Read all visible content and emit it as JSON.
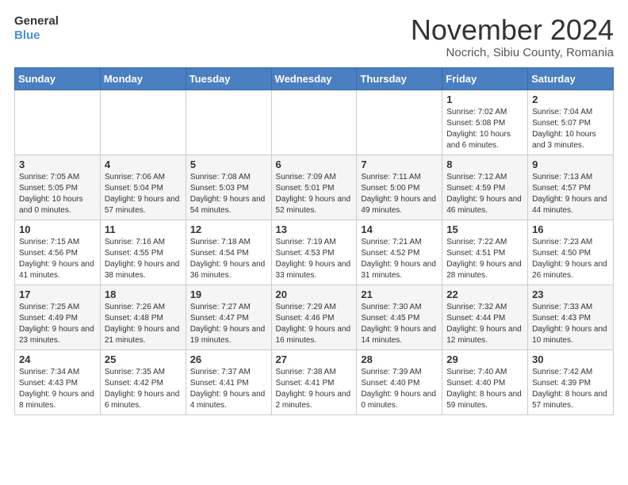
{
  "logo": {
    "general": "General",
    "blue": "Blue"
  },
  "title": "November 2024",
  "subtitle": "Nocrich, Sibiu County, Romania",
  "days_of_week": [
    "Sunday",
    "Monday",
    "Tuesday",
    "Wednesday",
    "Thursday",
    "Friday",
    "Saturday"
  ],
  "weeks": [
    [
      {
        "day": "",
        "info": ""
      },
      {
        "day": "",
        "info": ""
      },
      {
        "day": "",
        "info": ""
      },
      {
        "day": "",
        "info": ""
      },
      {
        "day": "",
        "info": ""
      },
      {
        "day": "1",
        "info": "Sunrise: 7:02 AM\nSunset: 5:08 PM\nDaylight: 10 hours and 6 minutes."
      },
      {
        "day": "2",
        "info": "Sunrise: 7:04 AM\nSunset: 5:07 PM\nDaylight: 10 hours and 3 minutes."
      }
    ],
    [
      {
        "day": "3",
        "info": "Sunrise: 7:05 AM\nSunset: 5:05 PM\nDaylight: 10 hours and 0 minutes."
      },
      {
        "day": "4",
        "info": "Sunrise: 7:06 AM\nSunset: 5:04 PM\nDaylight: 9 hours and 57 minutes."
      },
      {
        "day": "5",
        "info": "Sunrise: 7:08 AM\nSunset: 5:03 PM\nDaylight: 9 hours and 54 minutes."
      },
      {
        "day": "6",
        "info": "Sunrise: 7:09 AM\nSunset: 5:01 PM\nDaylight: 9 hours and 52 minutes."
      },
      {
        "day": "7",
        "info": "Sunrise: 7:11 AM\nSunset: 5:00 PM\nDaylight: 9 hours and 49 minutes."
      },
      {
        "day": "8",
        "info": "Sunrise: 7:12 AM\nSunset: 4:59 PM\nDaylight: 9 hours and 46 minutes."
      },
      {
        "day": "9",
        "info": "Sunrise: 7:13 AM\nSunset: 4:57 PM\nDaylight: 9 hours and 44 minutes."
      }
    ],
    [
      {
        "day": "10",
        "info": "Sunrise: 7:15 AM\nSunset: 4:56 PM\nDaylight: 9 hours and 41 minutes."
      },
      {
        "day": "11",
        "info": "Sunrise: 7:16 AM\nSunset: 4:55 PM\nDaylight: 9 hours and 38 minutes."
      },
      {
        "day": "12",
        "info": "Sunrise: 7:18 AM\nSunset: 4:54 PM\nDaylight: 9 hours and 36 minutes."
      },
      {
        "day": "13",
        "info": "Sunrise: 7:19 AM\nSunset: 4:53 PM\nDaylight: 9 hours and 33 minutes."
      },
      {
        "day": "14",
        "info": "Sunrise: 7:21 AM\nSunset: 4:52 PM\nDaylight: 9 hours and 31 minutes."
      },
      {
        "day": "15",
        "info": "Sunrise: 7:22 AM\nSunset: 4:51 PM\nDaylight: 9 hours and 28 minutes."
      },
      {
        "day": "16",
        "info": "Sunrise: 7:23 AM\nSunset: 4:50 PM\nDaylight: 9 hours and 26 minutes."
      }
    ],
    [
      {
        "day": "17",
        "info": "Sunrise: 7:25 AM\nSunset: 4:49 PM\nDaylight: 9 hours and 23 minutes."
      },
      {
        "day": "18",
        "info": "Sunrise: 7:26 AM\nSunset: 4:48 PM\nDaylight: 9 hours and 21 minutes."
      },
      {
        "day": "19",
        "info": "Sunrise: 7:27 AM\nSunset: 4:47 PM\nDaylight: 9 hours and 19 minutes."
      },
      {
        "day": "20",
        "info": "Sunrise: 7:29 AM\nSunset: 4:46 PM\nDaylight: 9 hours and 16 minutes."
      },
      {
        "day": "21",
        "info": "Sunrise: 7:30 AM\nSunset: 4:45 PM\nDaylight: 9 hours and 14 minutes."
      },
      {
        "day": "22",
        "info": "Sunrise: 7:32 AM\nSunset: 4:44 PM\nDaylight: 9 hours and 12 minutes."
      },
      {
        "day": "23",
        "info": "Sunrise: 7:33 AM\nSunset: 4:43 PM\nDaylight: 9 hours and 10 minutes."
      }
    ],
    [
      {
        "day": "24",
        "info": "Sunrise: 7:34 AM\nSunset: 4:43 PM\nDaylight: 9 hours and 8 minutes."
      },
      {
        "day": "25",
        "info": "Sunrise: 7:35 AM\nSunset: 4:42 PM\nDaylight: 9 hours and 6 minutes."
      },
      {
        "day": "26",
        "info": "Sunrise: 7:37 AM\nSunset: 4:41 PM\nDaylight: 9 hours and 4 minutes."
      },
      {
        "day": "27",
        "info": "Sunrise: 7:38 AM\nSunset: 4:41 PM\nDaylight: 9 hours and 2 minutes."
      },
      {
        "day": "28",
        "info": "Sunrise: 7:39 AM\nSunset: 4:40 PM\nDaylight: 9 hours and 0 minutes."
      },
      {
        "day": "29",
        "info": "Sunrise: 7:40 AM\nSunset: 4:40 PM\nDaylight: 8 hours and 59 minutes."
      },
      {
        "day": "30",
        "info": "Sunrise: 7:42 AM\nSunset: 4:39 PM\nDaylight: 8 hours and 57 minutes."
      }
    ]
  ]
}
